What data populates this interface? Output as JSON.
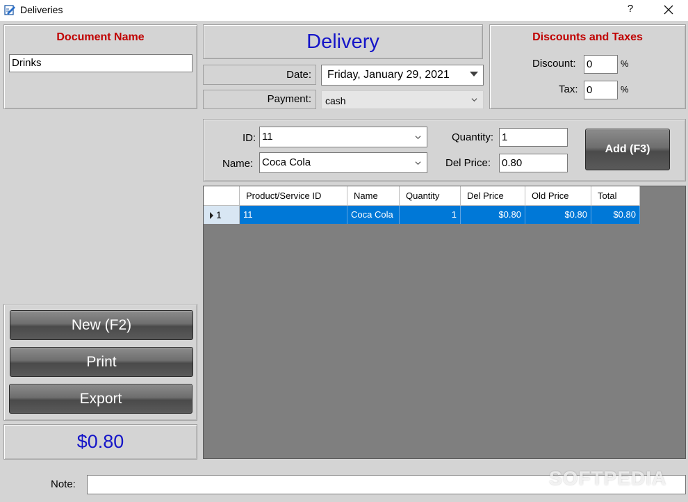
{
  "window": {
    "title": "Deliveries",
    "help_label": "?"
  },
  "document_name": {
    "heading": "Document Name",
    "value": "Drinks"
  },
  "delivery": {
    "heading": "Delivery",
    "date_label": "Date:",
    "date_value": "Friday, January 29, 2021",
    "payment_label": "Payment:",
    "payment_value": "cash"
  },
  "discounts": {
    "heading": "Discounts and Taxes",
    "discount_label": "Discount:",
    "discount_value": "0",
    "tax_label": "Tax:",
    "tax_value": "0",
    "percent": "%"
  },
  "entry": {
    "id_label": "ID:",
    "id_value": "11",
    "name_label": "Name:",
    "name_value": "Coca Cola",
    "quantity_label": "Quantity:",
    "quantity_value": "1",
    "del_price_label": "Del Price:",
    "del_price_value": "0.80",
    "add_button": "Add (F3)"
  },
  "grid": {
    "columns": [
      "Product/Service ID",
      "Name",
      "Quantity",
      "Del Price",
      "Old Price",
      "Total"
    ],
    "rows": [
      {
        "row_num": "1",
        "product_id": "11",
        "name": "Coca Cola",
        "quantity": "1",
        "del_price": "$0.80",
        "old_price": "$0.80",
        "total": "$0.80"
      }
    ]
  },
  "actions": {
    "new_button": "New (F2)",
    "print_button": "Print",
    "export_button": "Export"
  },
  "total_display": "$0.80",
  "note": {
    "label": "Note:",
    "value": ""
  },
  "watermark": "SOFTPEDIA",
  "colors": {
    "heading_red": "#c00000",
    "heading_blue": "#1515c8",
    "selection_blue": "#0078d7",
    "grid_background": "#7f7f7f"
  }
}
